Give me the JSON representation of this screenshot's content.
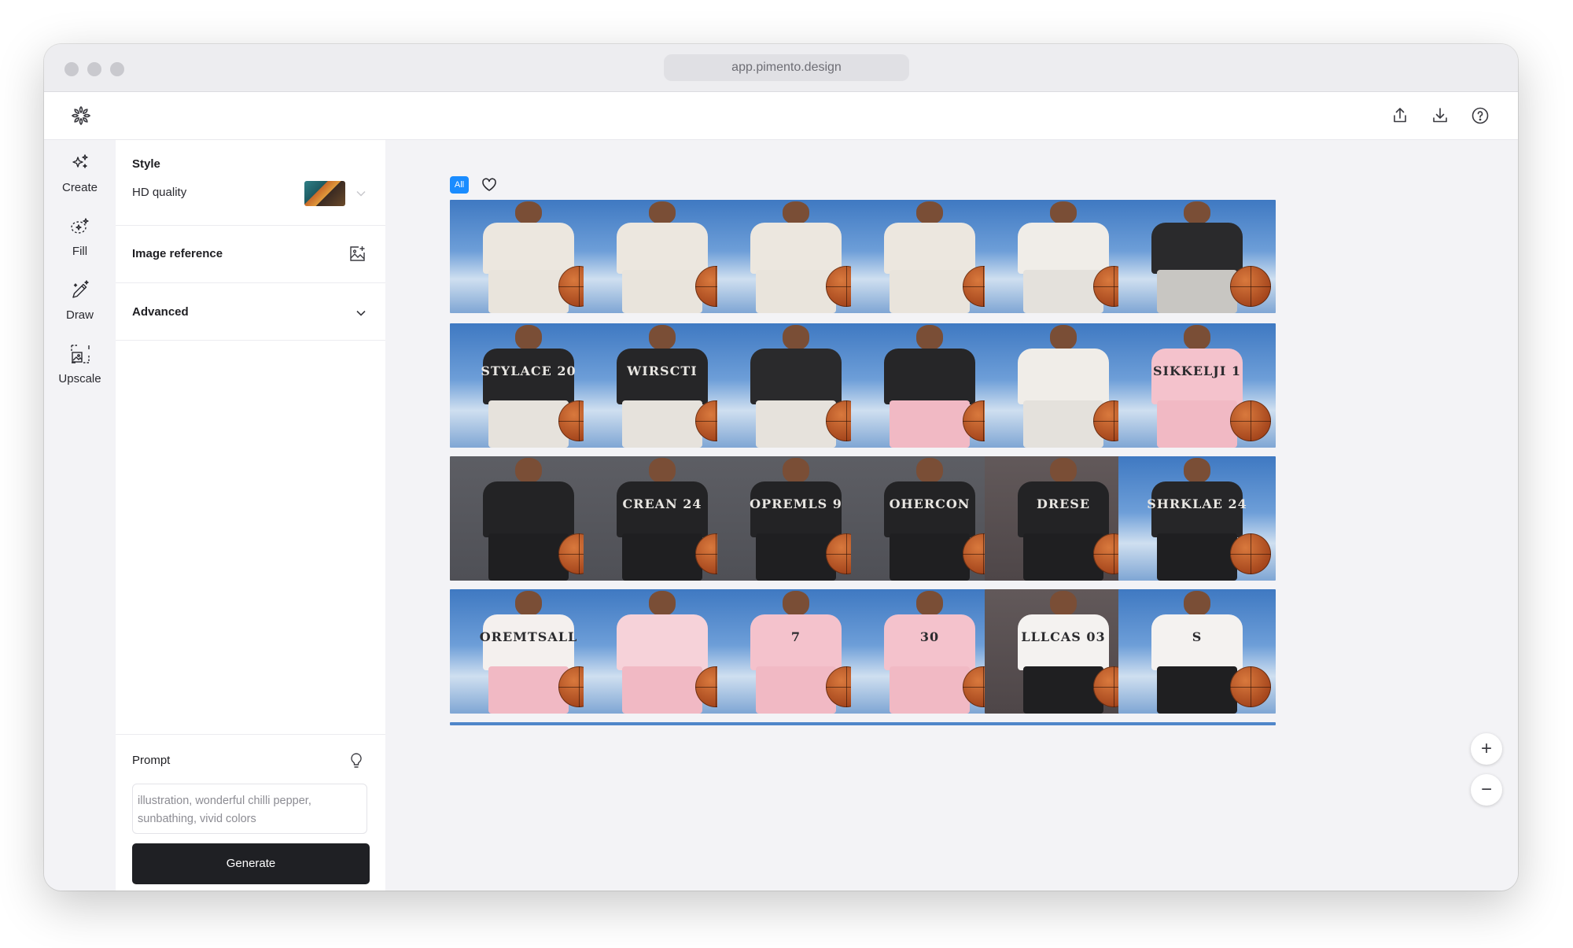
{
  "browser": {
    "url": "app.pimento.design"
  },
  "rail": [
    {
      "label": "Create"
    },
    {
      "label": "Fill"
    },
    {
      "label": "Draw"
    },
    {
      "label": "Upscale"
    }
  ],
  "panel": {
    "style_title": "Style",
    "quality_label": "HD quality",
    "image_reference_label": "Image reference",
    "advanced_label": "Advanced",
    "prompt_title": "Prompt",
    "prompt_placeholder": "illustration, wonderful chilli pepper, sunbathing, vivid colors",
    "generate_label": "Generate"
  },
  "gallery": {
    "filter_all_label": "All",
    "rows": [
      [
        {
          "bg": "sky",
          "top": "#ece7df",
          "shorts": "#e9e4dc",
          "num": ""
        },
        {
          "bg": "sky",
          "top": "#ece7df",
          "shorts": "#e9e4dc",
          "num": ""
        },
        {
          "bg": "sky",
          "top": "#ece7df",
          "shorts": "#e9e4dc",
          "num": ""
        },
        {
          "bg": "sky",
          "top": "#ece7df",
          "shorts": "#e9e4dc",
          "num": ""
        },
        {
          "bg": "sky",
          "top": "#f0ede8",
          "shorts": "#e4e1dc",
          "num": ""
        },
        {
          "bg": "sky",
          "top": "#2a2a2c",
          "shorts": "#c8c6c2",
          "num": ""
        }
      ],
      [
        {
          "bg": "sky",
          "top": "#262628",
          "shorts": "#e6e2dc",
          "num": "STYLACE 20"
        },
        {
          "bg": "sky",
          "top": "#262628",
          "shorts": "#e6e2dc",
          "num": "WIRSCTI"
        },
        {
          "bg": "sky",
          "top": "#2a2a2c",
          "shorts": "#e6e2dc",
          "num": ""
        },
        {
          "bg": "sky",
          "top": "#262628",
          "shorts": "#f1b9c4",
          "num": ""
        },
        {
          "bg": "sky",
          "top": "#f0ede8",
          "shorts": "#e4e1dc",
          "num": ""
        },
        {
          "bg": "sky",
          "top": "#f4c2cc",
          "shorts": "#f1b9c4",
          "num": "SIKKELJI 1"
        }
      ],
      [
        {
          "bg": "wall",
          "top": "#232325",
          "shorts": "#1f1f21",
          "num": ""
        },
        {
          "bg": "wall",
          "top": "#232325",
          "shorts": "#1f1f21",
          "num": "CREAN 24"
        },
        {
          "bg": "wall",
          "top": "#232325",
          "shorts": "#1f1f21",
          "num": "OPREMLS 9"
        },
        {
          "bg": "wall",
          "top": "#232325",
          "shorts": "#1f1f21",
          "num": "OHERCON"
        },
        {
          "bg": "dusk",
          "top": "#232325",
          "shorts": "#1f1f21",
          "num": "DRESE"
        },
        {
          "bg": "sky",
          "top": "#262628",
          "shorts": "#1f1f21",
          "num": "SHRKLAE 24"
        }
      ],
      [
        {
          "bg": "sky",
          "top": "#f4f0ee",
          "shorts": "#f1b9c4",
          "num": "OREMTSALL"
        },
        {
          "bg": "sky",
          "top": "#f6d2d9",
          "shorts": "#f1b9c4",
          "num": ""
        },
        {
          "bg": "sky",
          "top": "#f4c2cc",
          "shorts": "#f1b9c4",
          "num": "7"
        },
        {
          "bg": "sky",
          "top": "#f4c2cc",
          "shorts": "#f1b9c4",
          "num": "30"
        },
        {
          "bg": "dusk",
          "top": "#f4f2f0",
          "shorts": "#1f1f21",
          "num": "LLLCAS 03"
        },
        {
          "bg": "sky",
          "top": "#f4f2f0",
          "shorts": "#1f1f21",
          "num": "S"
        }
      ]
    ]
  },
  "colors": {
    "accent": "#1a8cff",
    "generate_bg": "#1f2024",
    "sky": "#4f86c9",
    "wall": "#55565c"
  }
}
